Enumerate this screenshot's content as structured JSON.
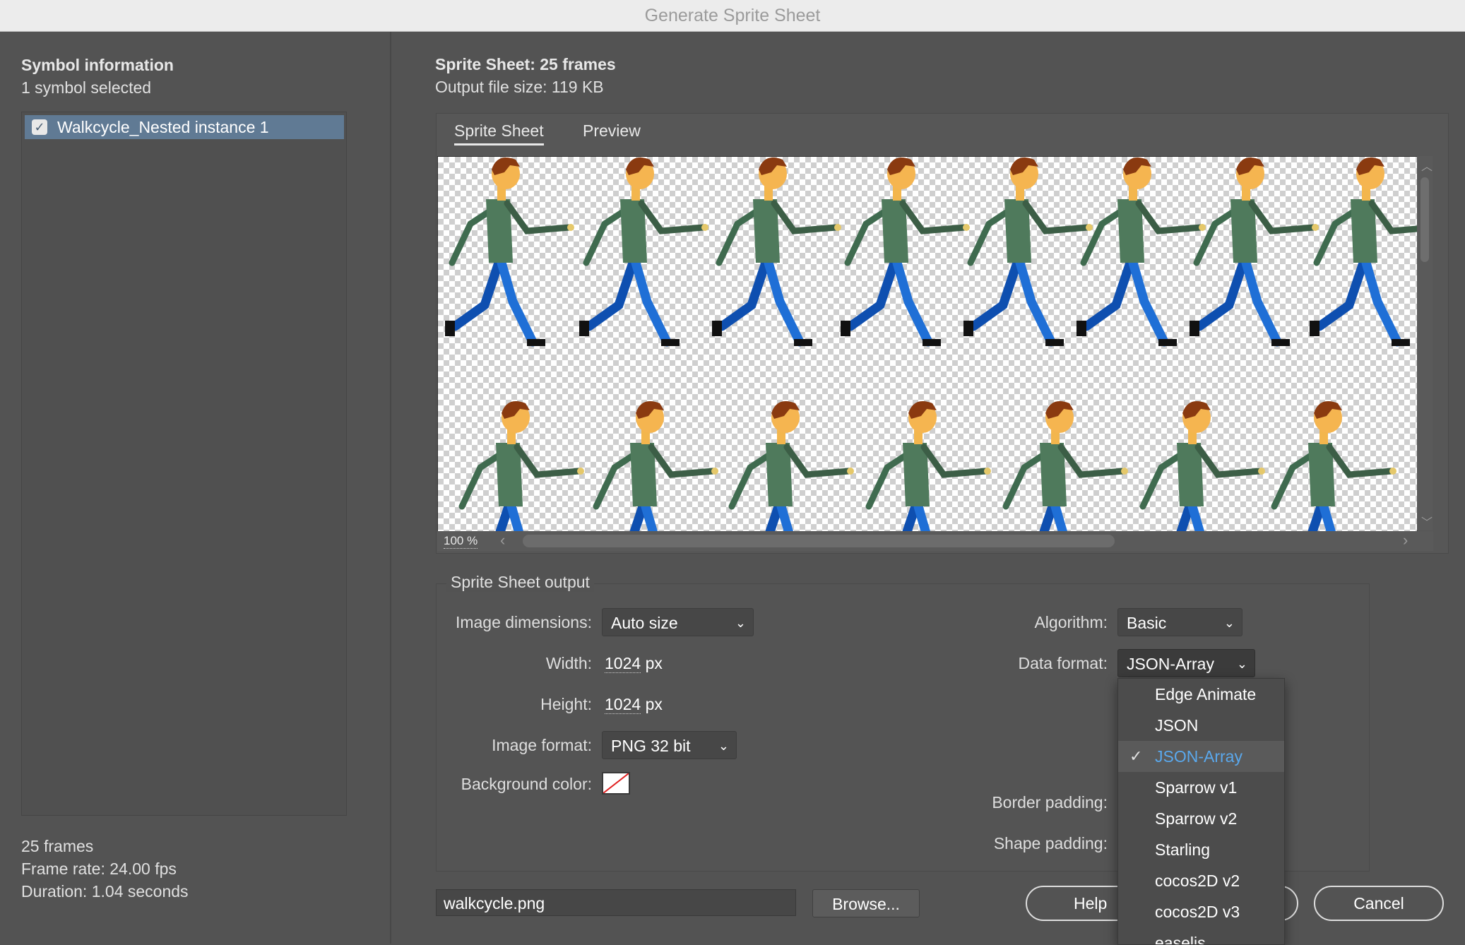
{
  "window": {
    "title": "Generate Sprite Sheet"
  },
  "symbol_info": {
    "heading": "Symbol information",
    "subheading": "1 symbol selected",
    "items": [
      {
        "label": "Walkcycle_Nested instance 1",
        "checked": true
      }
    ]
  },
  "stats": {
    "frames": "25 frames",
    "frame_rate": "Frame rate: 24.00 fps",
    "duration": "Duration: 1.04 seconds"
  },
  "sheet": {
    "heading": "Sprite Sheet: 25 frames",
    "file_size": "Output file size: 119 KB"
  },
  "tabs": [
    {
      "label": "Sprite Sheet",
      "active": true
    },
    {
      "label": "Preview",
      "active": false
    }
  ],
  "preview": {
    "zoom": "100 %"
  },
  "output": {
    "title": "Sprite Sheet output",
    "image_dimensions_label": "Image dimensions:",
    "image_dimensions_value": "Auto size",
    "width_label": "Width:",
    "width_value": "1024",
    "height_label": "Height:",
    "height_value": "1024",
    "unit": "px",
    "image_format_label": "Image format:",
    "image_format_value": "PNG 32 bit",
    "background_color_label": "Background color:",
    "algorithm_label": "Algorithm:",
    "algorithm_value": "Basic",
    "data_format_label": "Data format:",
    "data_format_value": "JSON-Array",
    "border_padding_label": "Border padding:",
    "shape_padding_label": "Shape padding:"
  },
  "data_format_menu": {
    "options": [
      "Edge Animate",
      "JSON",
      "JSON-Array",
      "Sparrow v1",
      "Sparrow v2",
      "Starling",
      "cocos2D v2",
      "cocos2D v3",
      "easelis"
    ],
    "selected": "JSON-Array"
  },
  "footer": {
    "filename": "walkcycle.png",
    "browse": "Browse...",
    "help": "Help",
    "cancel": "Cancel"
  },
  "colors": {
    "accent": "#5aa8ec",
    "selection": "#607a94",
    "panel": "#535353"
  },
  "icons": [
    "checkbox-icon",
    "chevron-down-icon",
    "checkmark-icon",
    "scroll-up-icon",
    "scroll-down-icon",
    "scroll-left-icon",
    "scroll-right-icon"
  ]
}
